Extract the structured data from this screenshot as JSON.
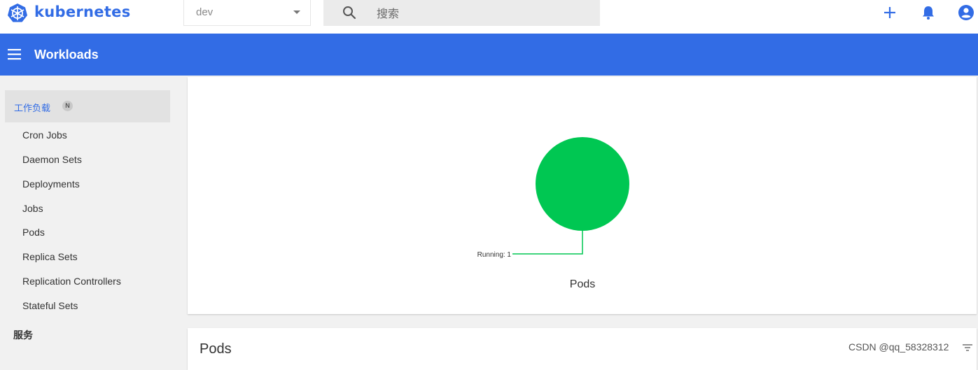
{
  "header": {
    "brand": "kubernetes",
    "namespace": "dev",
    "search_placeholder": "搜索"
  },
  "appbar": {
    "title": "Workloads"
  },
  "sidebar": {
    "section": {
      "label": "工作负载",
      "badge": "N"
    },
    "items": [
      {
        "label": "Cron Jobs"
      },
      {
        "label": "Daemon Sets"
      },
      {
        "label": "Deployments"
      },
      {
        "label": "Jobs"
      },
      {
        "label": "Pods"
      },
      {
        "label": "Replica Sets"
      },
      {
        "label": "Replication Controllers"
      },
      {
        "label": "Stateful Sets"
      }
    ],
    "next_section": "服务"
  },
  "colors": {
    "primary": "#326ce5",
    "running": "#00c752"
  },
  "chart_data": {
    "type": "pie",
    "title": "Pods",
    "slices": [
      {
        "label": "Running",
        "value": 1,
        "color": "#00c752"
      }
    ],
    "label_text": "Running: 1"
  },
  "pods_card": {
    "title": "Pods"
  },
  "watermark": "CSDN @qq_58328312"
}
